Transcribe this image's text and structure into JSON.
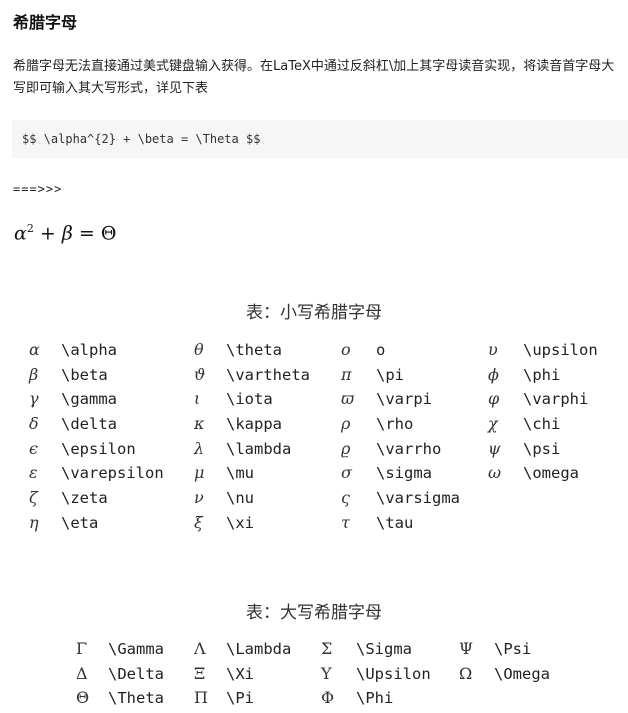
{
  "doc": {
    "title": "希腊字母",
    "description": "希腊字母无法直接通过美式键盘输入获得。在LaTeX中通过反斜杠\\加上其字母读音实现，将读音首字母大写即可输入其大写形式，详见下表",
    "code": "$$ \\alpha^{2} + \\beta = \\Theta  $$",
    "arrow": "===>>>",
    "formula": {
      "alpha": "α",
      "power": "2",
      "plus": " + ",
      "beta": "β",
      "eq": " = ",
      "theta": "Θ"
    }
  },
  "lowercase_table": {
    "caption": "表：小写希腊字母",
    "columns": [
      [
        {
          "sym": "α",
          "cmd": "\\alpha"
        },
        {
          "sym": "β",
          "cmd": "\\beta"
        },
        {
          "sym": "γ",
          "cmd": "\\gamma"
        },
        {
          "sym": "δ",
          "cmd": "\\delta"
        },
        {
          "sym": "ϵ",
          "cmd": "\\epsilon"
        },
        {
          "sym": "ε",
          "cmd": "\\varepsilon"
        },
        {
          "sym": "ζ",
          "cmd": "\\zeta"
        },
        {
          "sym": "η",
          "cmd": "\\eta"
        }
      ],
      [
        {
          "sym": "θ",
          "cmd": "\\theta"
        },
        {
          "sym": "ϑ",
          "cmd": "\\vartheta"
        },
        {
          "sym": "ι",
          "cmd": "\\iota"
        },
        {
          "sym": "κ",
          "cmd": "\\kappa"
        },
        {
          "sym": "λ",
          "cmd": "\\lambda"
        },
        {
          "sym": "μ",
          "cmd": "\\mu"
        },
        {
          "sym": "ν",
          "cmd": "\\nu"
        },
        {
          "sym": "ξ",
          "cmd": "\\xi"
        }
      ],
      [
        {
          "sym": "o",
          "cmd": "o"
        },
        {
          "sym": "π",
          "cmd": "\\pi"
        },
        {
          "sym": "ϖ",
          "cmd": "\\varpi"
        },
        {
          "sym": "ρ",
          "cmd": "\\rho"
        },
        {
          "sym": "ϱ",
          "cmd": "\\varrho"
        },
        {
          "sym": "σ",
          "cmd": "\\sigma"
        },
        {
          "sym": "ς",
          "cmd": "\\varsigma"
        },
        {
          "sym": "τ",
          "cmd": "\\tau"
        }
      ],
      [
        {
          "sym": "υ",
          "cmd": "\\upsilon"
        },
        {
          "sym": "ϕ",
          "cmd": "\\phi"
        },
        {
          "sym": "φ",
          "cmd": "\\varphi"
        },
        {
          "sym": "χ",
          "cmd": "\\chi"
        },
        {
          "sym": "ψ",
          "cmd": "\\psi"
        },
        {
          "sym": "ω",
          "cmd": "\\omega"
        }
      ]
    ]
  },
  "uppercase_table": {
    "caption": "表：大写希腊字母",
    "columns": [
      [
        {
          "sym": "Γ",
          "cmd": "\\Gamma"
        },
        {
          "sym": "Δ",
          "cmd": "\\Delta"
        },
        {
          "sym": "Θ",
          "cmd": "\\Theta"
        }
      ],
      [
        {
          "sym": "Λ",
          "cmd": "\\Lambda"
        },
        {
          "sym": "Ξ",
          "cmd": "\\Xi"
        },
        {
          "sym": "Π",
          "cmd": "\\Pi"
        }
      ],
      [
        {
          "sym": "Σ",
          "cmd": "\\Sigma"
        },
        {
          "sym": "Υ",
          "cmd": "\\Upsilon"
        },
        {
          "sym": "Φ",
          "cmd": "\\Phi"
        }
      ],
      [
        {
          "sym": "Ψ",
          "cmd": "\\Psi"
        },
        {
          "sym": "Ω",
          "cmd": "\\Omega"
        }
      ]
    ]
  }
}
